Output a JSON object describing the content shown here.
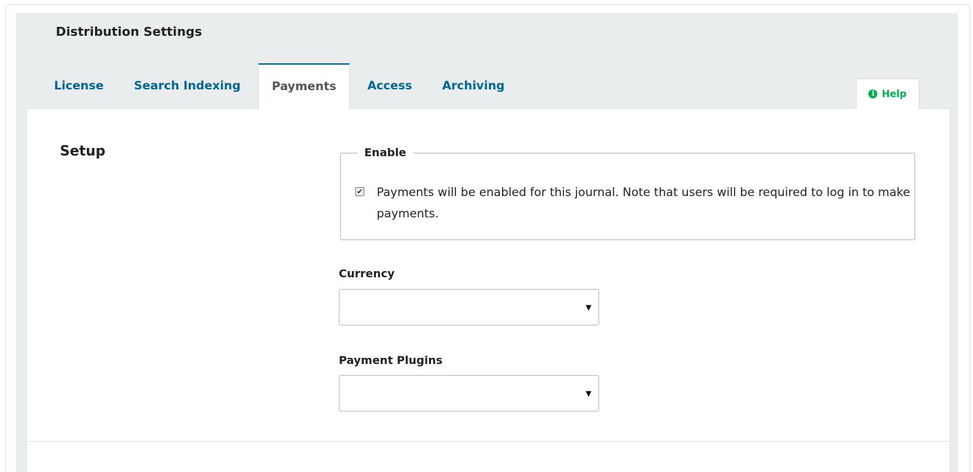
{
  "header": {
    "title": "Distribution Settings"
  },
  "tabs": [
    {
      "label": "License",
      "active": false
    },
    {
      "label": "Search Indexing",
      "active": false
    },
    {
      "label": "Payments",
      "active": true
    },
    {
      "label": "Access",
      "active": false
    },
    {
      "label": "Archiving",
      "active": false
    }
  ],
  "help": {
    "label": "Help",
    "icon": "info-icon"
  },
  "setup": {
    "title": "Setup",
    "enable": {
      "legend": "Enable",
      "checked": true,
      "checkbox_label": "Payments will be enabled for this journal. Note that users will be required to log in to make payments."
    },
    "currency": {
      "label": "Currency",
      "value": ""
    },
    "payment_plugins": {
      "label": "Payment Plugins",
      "value": ""
    }
  },
  "colors": {
    "link": "#006798",
    "help": "#00b24e",
    "panel_bg": "#eaedee",
    "border": "#dddddd"
  }
}
